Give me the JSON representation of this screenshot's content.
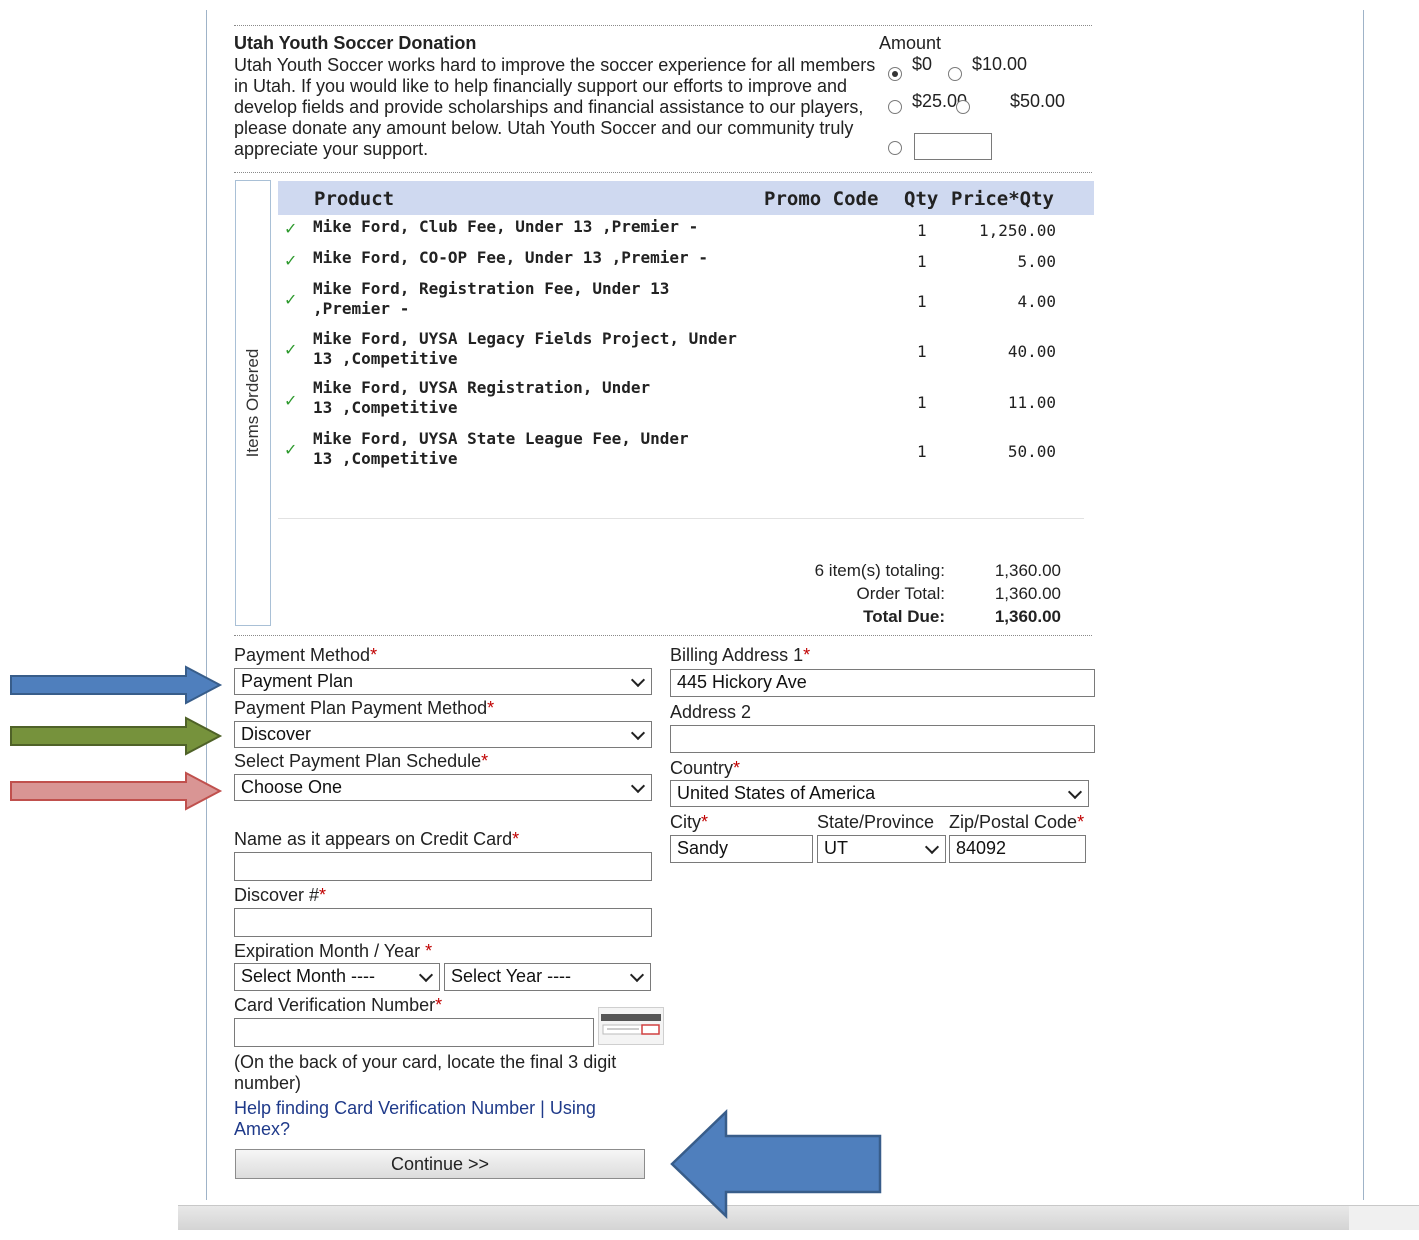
{
  "donation": {
    "title": "Utah Youth Soccer Donation",
    "description": "Utah Youth Soccer works hard to improve the soccer experience for all members in Utah. If you would like to help financially support our efforts to improve and develop fields and provide scholarships and financial assistance to our players, please donate any amount below. Utah Youth Soccer and our community truly appreciate your support.",
    "amount_label": "Amount",
    "options": [
      "$0",
      "$10.00",
      "$25.00",
      "$50.00"
    ],
    "selected": "$0",
    "custom_value": ""
  },
  "items": {
    "sidebar_label": "Items Ordered",
    "columns": {
      "product": "Product",
      "promo": "Promo Code",
      "qty": "Qty",
      "price": "Price*Qty"
    },
    "rows": [
      {
        "product": "Mike Ford, Club Fee, Under 13 ,Premier -",
        "qty": "1",
        "price": "1,250.00"
      },
      {
        "product": "Mike Ford, CO-OP Fee, Under 13 ,Premier -",
        "qty": "1",
        "price": "5.00"
      },
      {
        "product": "Mike Ford, Registration Fee, Under 13 ,Premier -",
        "qty": "1",
        "price": "4.00"
      },
      {
        "product": "Mike Ford, UYSA Legacy Fields Project, Under 13 ,Competitive",
        "qty": "1",
        "price": "40.00"
      },
      {
        "product": "Mike Ford, UYSA Registration, Under 13 ,Competitive",
        "qty": "1",
        "price": "11.00"
      },
      {
        "product": "Mike Ford, UYSA State League Fee, Under 13 ,Competitive",
        "qty": "1",
        "price": "50.00"
      }
    ]
  },
  "totals": {
    "items_label": "6 item(s) totaling:",
    "items_value": "1,360.00",
    "order_label": "Order Total:",
    "order_value": "1,360.00",
    "due_label": "Total Due:",
    "due_value": "1,360.00"
  },
  "payment": {
    "method_label": "Payment Method",
    "method_value": "Payment Plan",
    "plan_method_label": "Payment Plan Payment Method",
    "plan_method_value": "Discover",
    "schedule_label": "Select Payment Plan Schedule",
    "schedule_value": "Choose One",
    "name_label": "Name as it appears on Credit Card",
    "card_label": "Discover #",
    "exp_label": "Expiration Month / Year",
    "month_value": "Select Month ----",
    "year_value": "Select Year ----",
    "cvv_label": "Card Verification Number",
    "cvv_help": "(On the back of your card, locate the final 3 digit number)",
    "help_link": "Help finding Card Verification Number",
    "link_sep": "|",
    "amex_link": "Using Amex?",
    "continue": "Continue >>",
    "required_mark": "*"
  },
  "billing": {
    "address1_label": "Billing Address 1",
    "address1_value": "445 Hickory Ave",
    "address2_label": "Address 2",
    "address2_value": "",
    "country_label": "Country",
    "country_value": "United States of America",
    "city_label": "City",
    "city_value": "Sandy",
    "state_label": "State/Province",
    "state_value": "UT",
    "zip_label": "Zip/Postal Code",
    "zip_value": "84092"
  },
  "colors": {
    "arrow_blue": "#4f7fbd",
    "arrow_green": "#76923c",
    "arrow_pink": "#d99594",
    "header_bg": "#cfd9f0",
    "check": "#2e9a2e",
    "required": "#c00000",
    "link": "#1f3a8a"
  }
}
